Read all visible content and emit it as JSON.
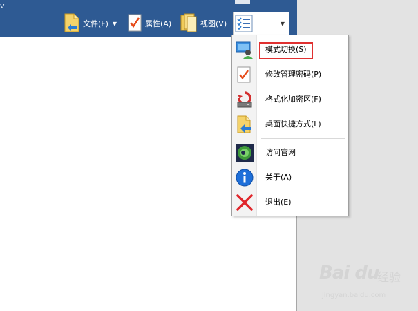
{
  "window": {
    "title_fragment": "v"
  },
  "toolbar": {
    "file_label": "文件(F)",
    "properties_label": "属性(A)",
    "view_label": "视图(V)",
    "file_icon": "file-arrow-icon",
    "properties_icon": "checklist-icon",
    "view_icon": "documents-icon",
    "menu_icon": "menu-list-icon"
  },
  "menu": {
    "items": [
      {
        "label": "模式切换(S)",
        "icon": "mode-switch-icon",
        "highlighted": true
      },
      {
        "label": "修改管理密码(P)",
        "icon": "password-check-icon",
        "highlighted": false
      },
      {
        "label": "格式化加密区(F)",
        "icon": "format-drive-icon",
        "highlighted": false
      },
      {
        "label": "桌面快捷方式(L)",
        "icon": "shortcut-icon",
        "highlighted": false
      },
      {
        "label": "访问官网",
        "icon": "website-icon",
        "highlighted": false
      },
      {
        "label": "关于(A)",
        "icon": "info-icon",
        "highlighted": false
      },
      {
        "label": "退出(E)",
        "icon": "exit-icon",
        "highlighted": false
      }
    ]
  },
  "watermark": {
    "logo": "Bai du",
    "cn": "经验",
    "url": "jingyan.baidu.com"
  },
  "colors": {
    "titlebar": "#2e5a93",
    "highlight_border": "#e03131",
    "menu_text": "#000000"
  }
}
